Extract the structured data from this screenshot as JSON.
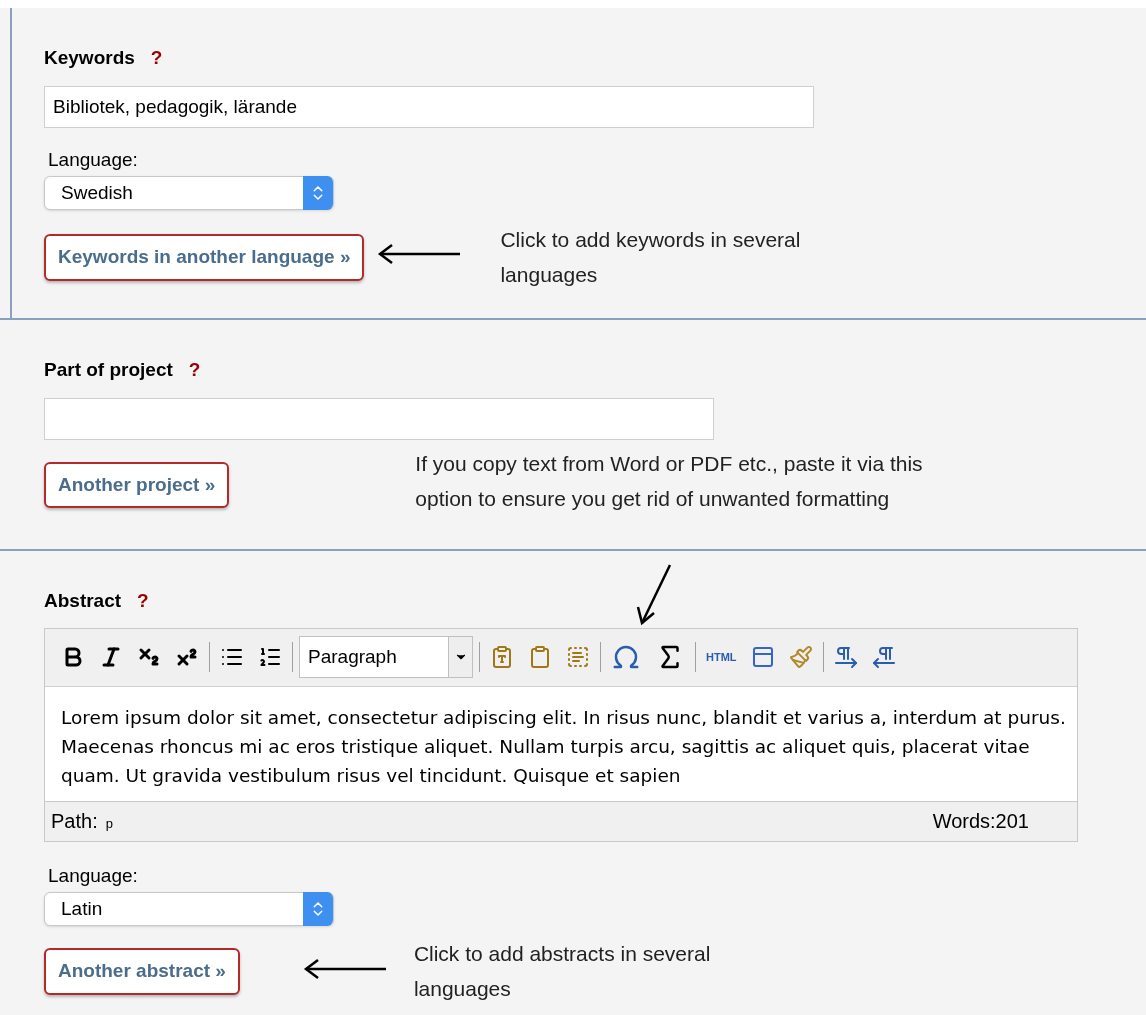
{
  "keywords": {
    "label": "Keywords",
    "help": "?",
    "value": "Bibliotek, pedagogik, lärande",
    "language_label": "Language:",
    "language": "Swedish",
    "button": "Keywords in another language »",
    "note": "Click to add keywords in several languages"
  },
  "project": {
    "label": "Part of project",
    "help": "?",
    "button": "Another project »",
    "note": "If you copy text from Word or PDF etc., paste it via this option to ensure you get rid of unwanted formatting"
  },
  "abstract": {
    "label": "Abstract",
    "help": "?",
    "toolbar": {
      "format_select": "Paragraph",
      "html_button": "HTML"
    },
    "text": "Lorem ipsum dolor sit amet, consectetur adipiscing elit. In risus nunc, blandit et varius a, interdum at purus. Maecenas rhoncus mi ac eros tristique aliquet. Nullam turpis arcu, sagittis ac aliquet quis, placerat vitae quam. Ut gravida vestibulum risus vel tincidunt. Quisque et sapien",
    "path_label": "Path:",
    "path": "p",
    "word_count": "Words:201",
    "language_label": "Language:",
    "language": "Latin",
    "button": "Another abstract »",
    "note": "Click to add abstracts in several languages"
  }
}
